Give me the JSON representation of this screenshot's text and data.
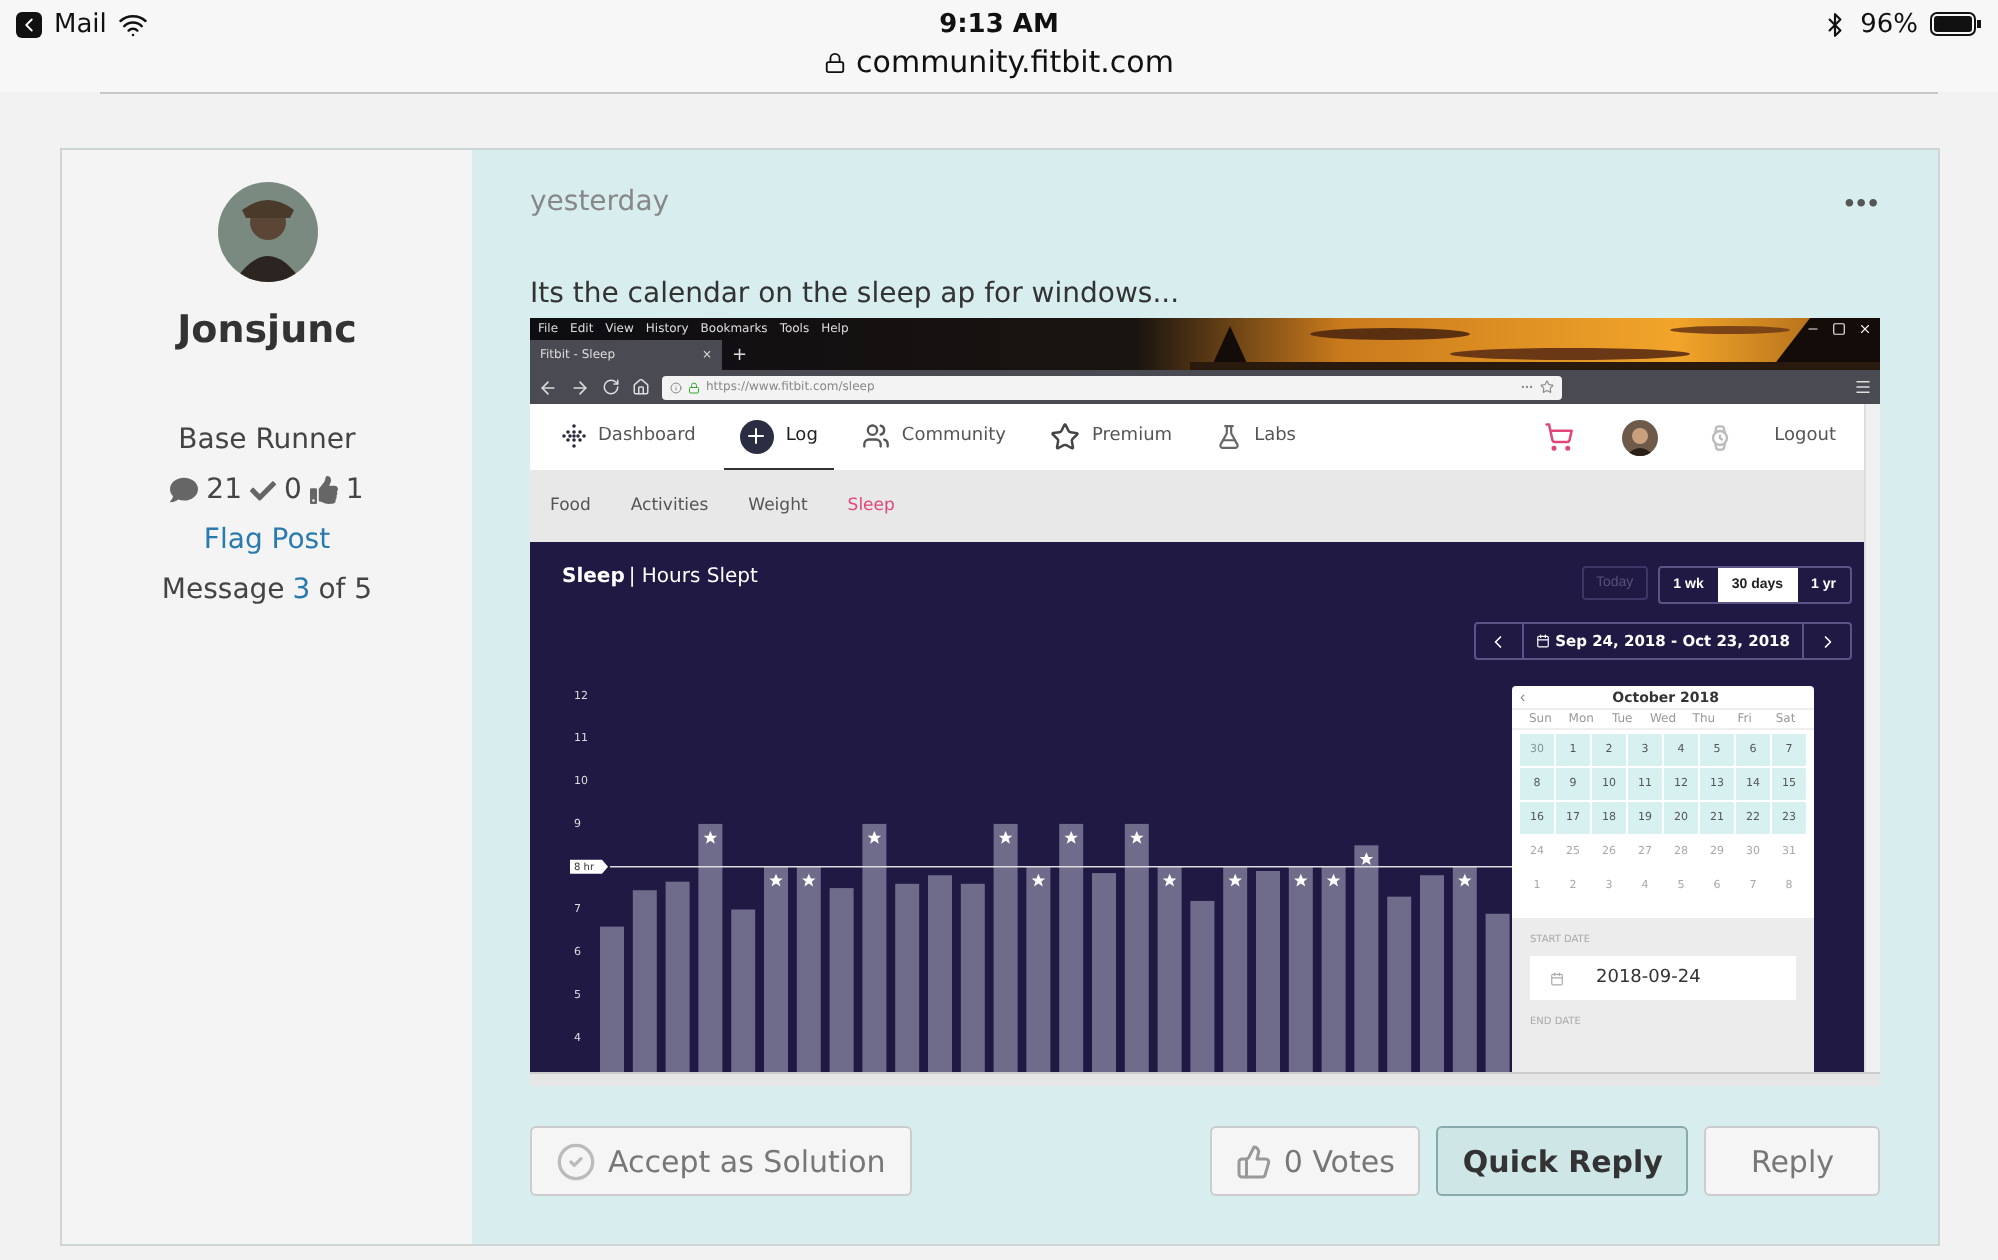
{
  "status_bar": {
    "back_app": "Mail",
    "time": "9:13 AM",
    "battery": "96%",
    "url": "community.fitbit.com"
  },
  "post": {
    "author": {
      "name": "Jonsjunc",
      "rank": "Base Runner",
      "posts": "21",
      "solutions": "0",
      "kudos": "1",
      "flag_link": "Flag Post",
      "message_prefix": "Message",
      "message_number": "3",
      "message_suffix": "of 5"
    },
    "time": "yesterday",
    "menu": "•••",
    "body": "Its the calendar on the sleep ap for windows...",
    "screenshot": {
      "menu_bar": [
        "File",
        "Edit",
        "View",
        "History",
        "Bookmarks",
        "Tools",
        "Help"
      ],
      "tab": {
        "title": "Fitbit - Sleep",
        "close": "×"
      },
      "new_tab": "+",
      "url": "https://www.fitbit.com/sleep",
      "nav": [
        {
          "label": "Dashboard",
          "kind": "dashboard",
          "selected": false
        },
        {
          "label": "Log",
          "kind": "log",
          "selected": true
        },
        {
          "label": "Community",
          "kind": "community",
          "selected": false
        },
        {
          "label": "Premium",
          "kind": "premium",
          "selected": false
        },
        {
          "label": "Labs",
          "kind": "labs",
          "selected": false
        }
      ],
      "logout": "Logout",
      "subnav": [
        {
          "label": "Food",
          "selected": false
        },
        {
          "label": "Activities",
          "selected": false
        },
        {
          "label": "Weight",
          "selected": false
        },
        {
          "label": "Sleep",
          "selected": true
        }
      ],
      "title": "Sleep",
      "subtitle": "| Hours Slept",
      "today": {
        "label": "Today",
        "disabled": true
      },
      "ranges": [
        {
          "label": "1 wk",
          "selected": false
        },
        {
          "label": "30 days",
          "selected": true
        },
        {
          "label": "1 yr",
          "selected": false
        }
      ],
      "date_range": "Sep 24, 2018 - Oct 23, 2018",
      "chart_data": {
        "type": "bar",
        "ylim": [
          3.2,
          12
        ],
        "yticks": [
          4,
          5,
          6,
          7,
          9,
          10,
          11,
          12
        ],
        "values": [
          6.6,
          7.45,
          7.65,
          9,
          7,
          8,
          8,
          7.5,
          9,
          7.6,
          7.8,
          7.6,
          9,
          8,
          9,
          7.85,
          9,
          8,
          7.2,
          8,
          7.9,
          8,
          8,
          8.5,
          7.3,
          7.8,
          8,
          6.9
        ],
        "ref_lines": [
          {
            "axis": "y",
            "value": 8,
            "label": "8 hr"
          }
        ]
      },
      "calendar": {
        "month": "October 2018",
        "prev": "‹",
        "weekdays": [
          "Sun",
          "Mon",
          "Tue",
          "Wed",
          "Thu",
          "Fri",
          "Sat"
        ],
        "weeks": [
          [
            {
              "label": "30",
              "in_range": true,
              "muted": true
            },
            {
              "label": "1",
              "in_range": true,
              "muted": false
            },
            {
              "label": "2",
              "in_range": true,
              "muted": false
            },
            {
              "label": "3",
              "in_range": true,
              "muted": false
            },
            {
              "label": "4",
              "in_range": true,
              "muted": false
            },
            {
              "label": "5",
              "in_range": true,
              "muted": false
            },
            {
              "label": "6",
              "in_range": true,
              "muted": false
            },
            {
              "label": "7",
              "in_range": true,
              "muted": false
            }
          ],
          [
            {
              "label": "8",
              "in_range": true,
              "muted": false
            },
            {
              "label": "9",
              "in_range": true,
              "muted": false
            },
            {
              "label": "10",
              "in_range": true,
              "muted": false
            },
            {
              "label": "11",
              "in_range": true,
              "muted": false
            },
            {
              "label": "12",
              "in_range": true,
              "muted": false
            },
            {
              "label": "13",
              "in_range": true,
              "muted": false
            },
            {
              "label": "14",
              "in_range": true,
              "muted": false
            },
            {
              "label": "15",
              "in_range": true,
              "muted": false
            }
          ],
          [
            {
              "label": "16",
              "in_range": true,
              "muted": false
            },
            {
              "label": "17",
              "in_range": true,
              "muted": false
            },
            {
              "label": "18",
              "in_range": true,
              "muted": false
            },
            {
              "label": "19",
              "in_range": true,
              "muted": false
            },
            {
              "label": "20",
              "in_range": true,
              "muted": false
            },
            {
              "label": "21",
              "in_range": true,
              "muted": false
            },
            {
              "label": "22",
              "in_range": true,
              "muted": false
            },
            {
              "label": "23",
              "in_range": true,
              "muted": false
            }
          ],
          [
            {
              "label": "24",
              "in_range": false,
              "muted": true
            },
            {
              "label": "25",
              "in_range": false,
              "muted": true
            },
            {
              "label": "26",
              "in_range": false,
              "muted": true
            },
            {
              "label": "27",
              "in_range": false,
              "muted": true
            },
            {
              "label": "28",
              "in_range": false,
              "muted": true
            },
            {
              "label": "29",
              "in_range": false,
              "muted": true
            },
            {
              "label": "30",
              "in_range": false,
              "muted": true
            },
            {
              "label": "31",
              "in_range": false,
              "muted": true
            }
          ],
          [
            {
              "label": "1",
              "in_range": false,
              "muted": true
            },
            {
              "label": "2",
              "in_range": false,
              "muted": true
            },
            {
              "label": "3",
              "in_range": false,
              "muted": true
            },
            {
              "label": "4",
              "in_range": false,
              "muted": true
            },
            {
              "label": "5",
              "in_range": false,
              "muted": true
            },
            {
              "label": "6",
              "in_range": false,
              "muted": true
            },
            {
              "label": "7",
              "in_range": false,
              "muted": true
            },
            {
              "label": "8",
              "in_range": false,
              "muted": true
            }
          ]
        ],
        "start_label": "START DATE",
        "start_value": "2018-09-24",
        "end_label": "END DATE"
      }
    },
    "actions": {
      "accept": "Accept as Solution",
      "votes": "0 Votes",
      "quick_reply": "Quick Reply",
      "reply": "Reply"
    }
  }
}
